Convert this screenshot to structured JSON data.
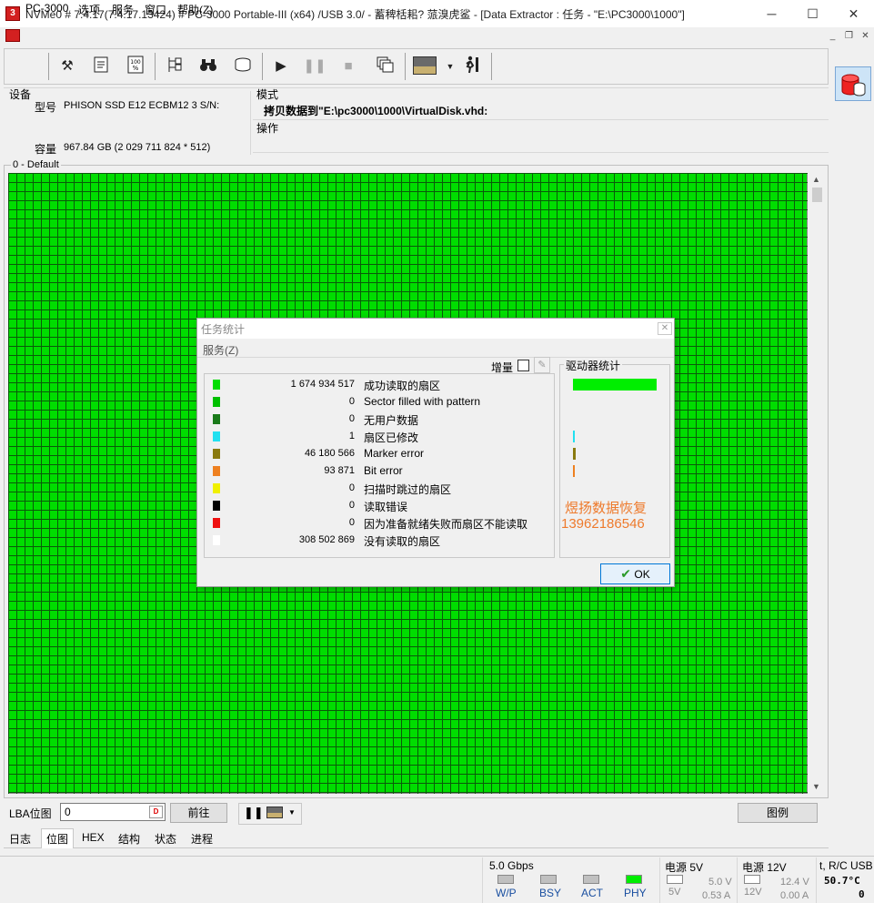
{
  "window": {
    "title": "NVMe0 # 7.4.17(7.4.17.13424) # PC-3000 Portable-III (x64) /USB 3.0/ - 蓄稗栝耜? 蒎溴虎鲨   - [Data Extractor : 任务 - \"E:\\PC3000\\1000\"]",
    "minimize": "─",
    "maximize": "☐",
    "close": "✕"
  },
  "menu": {
    "app": "PC-3000",
    "items": [
      "选项",
      "服务",
      "窗口",
      "帮助(Z)"
    ],
    "mdi_controls": [
      "_",
      "❐",
      "✕"
    ]
  },
  "toolbar": {
    "icons": [
      "tools-icon",
      "scroll-icon",
      "percent-icon",
      "tree-icon",
      "binoculars-icon",
      "disk-icon",
      "play-icon",
      "pause-icon",
      "stop-icon",
      "copy-windows-icon",
      "image-icon",
      "dropdown-icon",
      "exit-icon"
    ]
  },
  "info": {
    "device_label": "设备",
    "model_label": "型号",
    "model_value": "PHISON SSD E12 ECBM12 3 S/N:",
    "capacity_label": "容量",
    "capacity_value": "967.84 GB (2 029 711 824 * 512)",
    "mode_label": "模式",
    "mode_value": "拷贝数据到\"E:\\pc3000\\1000\\VirtualDisk.vhd:",
    "operation_label": "操作"
  },
  "bitmap": {
    "group_label": "0 - Default",
    "fill_color": "#00dd00"
  },
  "controls": {
    "lba_label": "LBA位图",
    "lba_value": "0",
    "goto_button": "前往",
    "legend_button": "图例"
  },
  "tabs": [
    "日志",
    "位图",
    "HEX",
    "结构",
    "状态",
    "进程"
  ],
  "active_tab": "位图",
  "status": {
    "speed": "5.0 Gbps",
    "leds": [
      {
        "label": "W/P",
        "color": "#c0c0c0"
      },
      {
        "label": "BSY",
        "color": "#c0c0c0"
      },
      {
        "label": "ACT",
        "color": "#c0c0c0"
      },
      {
        "label": "PHY",
        "color": "#00ee00"
      }
    ],
    "power5_label": "电源 5V",
    "power5_led": "5V",
    "power5_volt": "5.0 V",
    "power5_amp": "0.53 A",
    "power12_label": "电源 12V",
    "power12_led": "12V",
    "power12_volt": "12.4 V",
    "power12_amp": "0.00 A",
    "temp_label": "t, R/C USB",
    "temp_value": "50.7°C",
    "temp_count": "0"
  },
  "dialog": {
    "title": "任务统计",
    "close": "✕",
    "menu": "服务(Z)",
    "increment_label": "增量",
    "drive_stats_label": "驱动器统计",
    "ok_label": "OK",
    "rows": [
      {
        "color": "#00dd00",
        "value": "1 674 934 517",
        "label": "成功读取的扇区"
      },
      {
        "color": "#00c000",
        "value": "0",
        "label": "Sector filled with pattern"
      },
      {
        "color": "#1a7a1a",
        "value": "0",
        "label": "无用户数据"
      },
      {
        "color": "#22e0f0",
        "value": "1",
        "label": "扇区已修改"
      },
      {
        "color": "#8a7a10",
        "value": "46 180 566",
        "label": "Marker error"
      },
      {
        "color": "#ee8020",
        "value": "93 871",
        "label": "Bit error"
      },
      {
        "color": "#f0f000",
        "value": "0",
        "label": "扫描时跳过的扇区"
      },
      {
        "color": "#000000",
        "value": "0",
        "label": "读取错误"
      },
      {
        "color": "#ee1010",
        "value": "0",
        "label": "因为准备就绪失败而扇区不能读取"
      },
      {
        "color": "#ffffff",
        "value": "308 502 869",
        "label": "没有读取的扇区"
      }
    ],
    "watermark_name": "煜扬数据恢复",
    "watermark_phone": "13962186546"
  }
}
